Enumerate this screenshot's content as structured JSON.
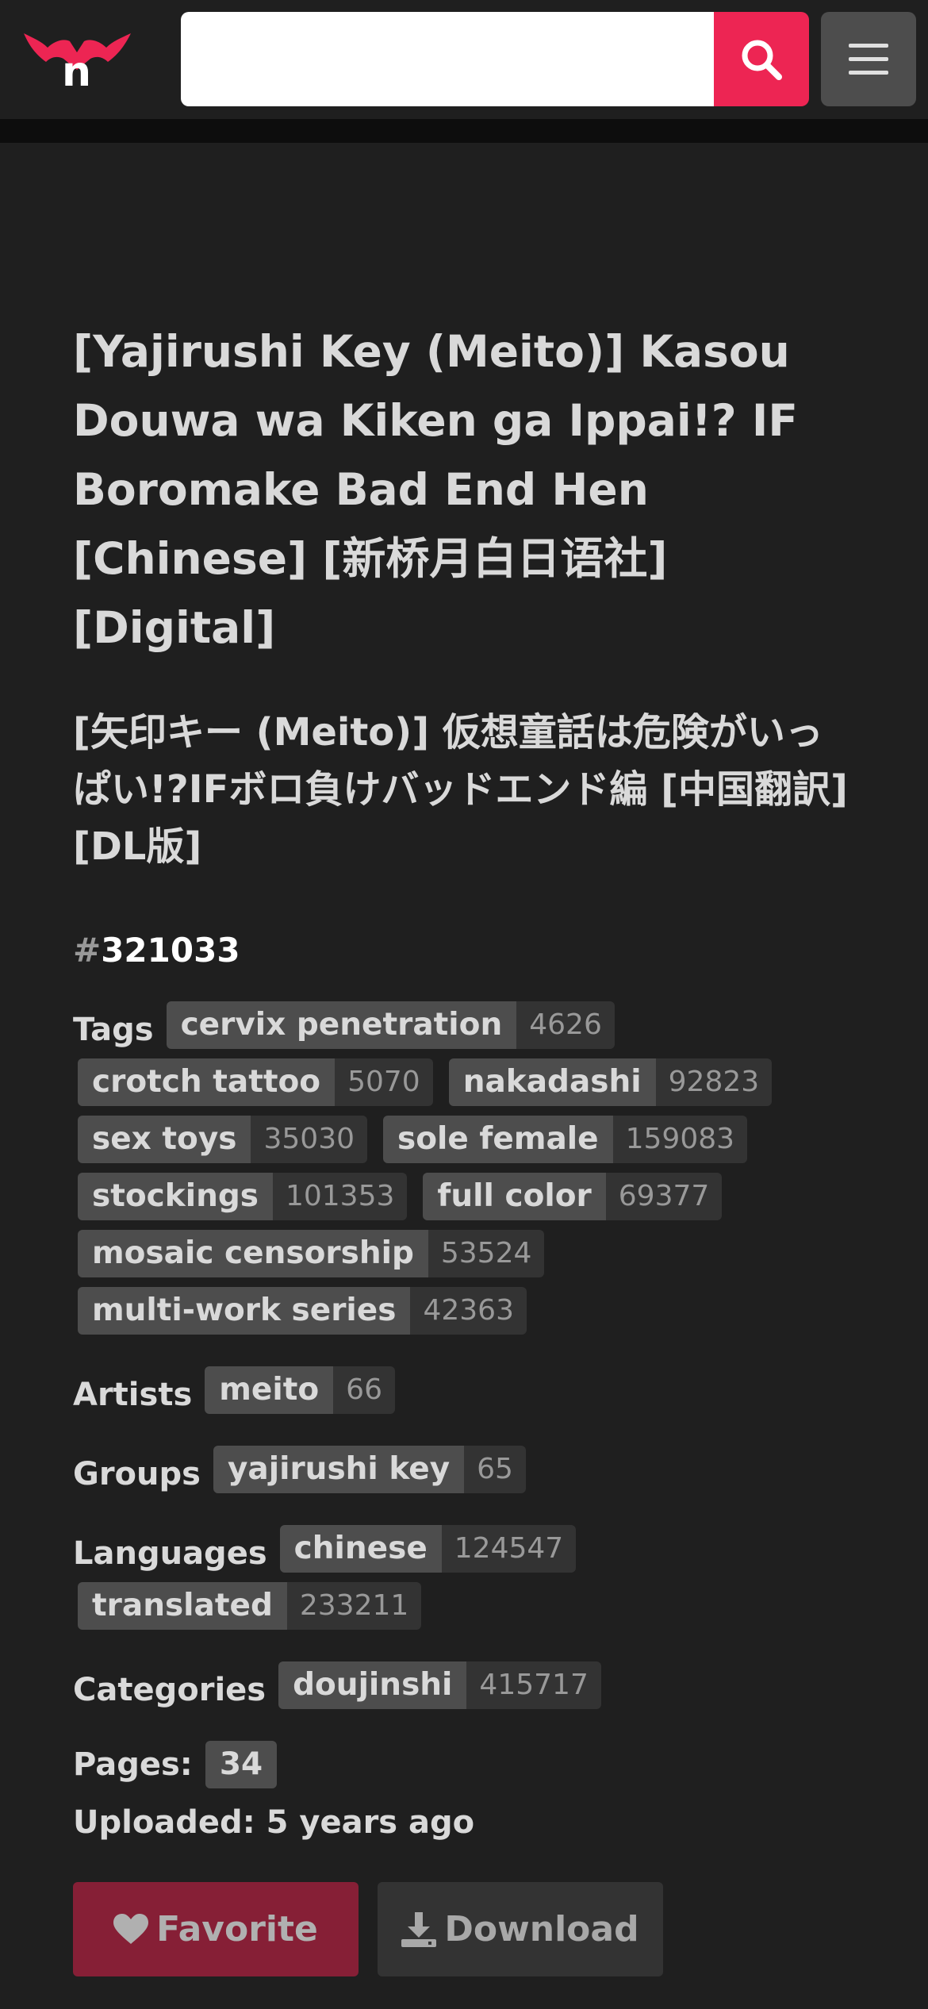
{
  "header": {
    "logo_letter": "n",
    "search_placeholder": "",
    "accent_color": "#ed2553"
  },
  "gallery": {
    "title_english": "[Yajirushi Key (Meito)] Kasou Douwa wa Kiken ga Ippai!? IF Boromake Bad End Hen [Chinese] [新桥月白日语社] [Digital]",
    "title_japanese": "[矢印キー (Meito)] 仮想童話は危険がいっぱい!?IFボロ負けバッドエンド編 [中国翻訳] [DL版]",
    "id_hash": "#",
    "id": "321033"
  },
  "tags": {
    "label": "Tags",
    "items": [
      {
        "name": "cervix penetration",
        "count": "4626"
      },
      {
        "name": "crotch tattoo",
        "count": "5070"
      },
      {
        "name": "nakadashi",
        "count": "92823"
      },
      {
        "name": "sex toys",
        "count": "35030"
      },
      {
        "name": "sole female",
        "count": "159083"
      },
      {
        "name": "stockings",
        "count": "101353"
      },
      {
        "name": "full color",
        "count": "69377"
      },
      {
        "name": "mosaic censorship",
        "count": "53524"
      },
      {
        "name": "multi-work series",
        "count": "42363"
      }
    ]
  },
  "artists": {
    "label": "Artists",
    "items": [
      {
        "name": "meito",
        "count": "66"
      }
    ]
  },
  "groups": {
    "label": "Groups",
    "items": [
      {
        "name": "yajirushi key",
        "count": "65"
      }
    ]
  },
  "languages": {
    "label": "Languages",
    "items": [
      {
        "name": "chinese",
        "count": "124547"
      },
      {
        "name": "translated",
        "count": "233211"
      }
    ]
  },
  "categories": {
    "label": "Categories",
    "items": [
      {
        "name": "doujinshi",
        "count": "415717"
      }
    ]
  },
  "pages": {
    "label": "Pages:",
    "value": "34"
  },
  "uploaded": {
    "label": "Uploaded:",
    "value": "5 years ago"
  },
  "actions": {
    "favorite_label": "Favorite",
    "download_label": "Download"
  },
  "icons": {
    "search": "search-icon",
    "menu": "hamburger-menu-icon",
    "favorite": "heart-icon",
    "download": "download-icon",
    "logo": "bat-wing-logo"
  }
}
